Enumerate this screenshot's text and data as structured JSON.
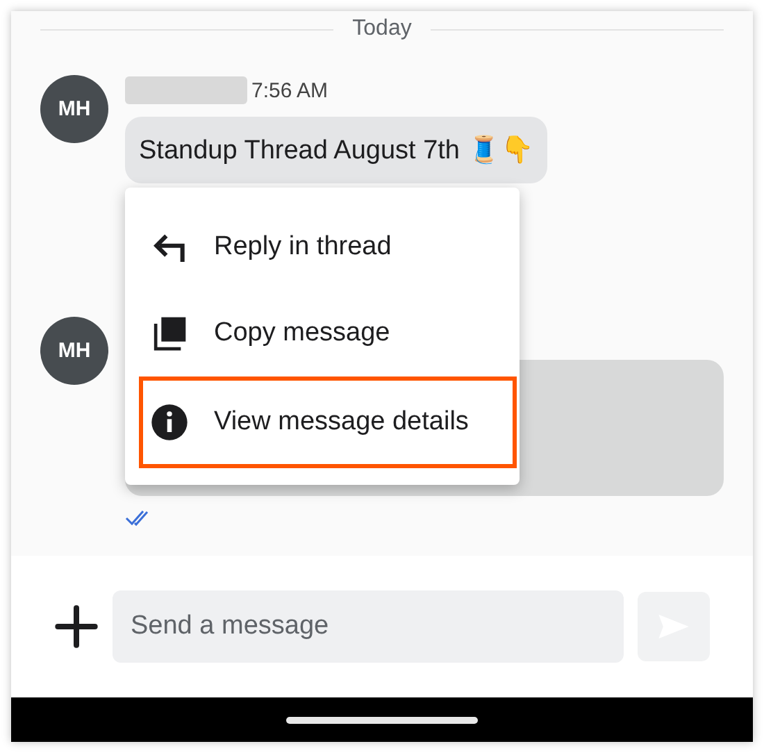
{
  "date_divider": "Today",
  "messages": [
    {
      "avatar": "MH",
      "time": "7:56 AM",
      "text": "Standup Thread August 7th 🧵👇",
      "name_redacted": true
    },
    {
      "avatar": "MH",
      "redacted": true,
      "read": true
    }
  ],
  "context_menu": [
    {
      "kind": "reply",
      "label": "Reply in thread",
      "highlighted": false
    },
    {
      "kind": "copy",
      "label": "Copy message",
      "highlighted": false
    },
    {
      "kind": "info",
      "label": "View message details",
      "highlighted": true
    }
  ],
  "composer": {
    "placeholder": "Send a message",
    "send_disabled": true
  }
}
